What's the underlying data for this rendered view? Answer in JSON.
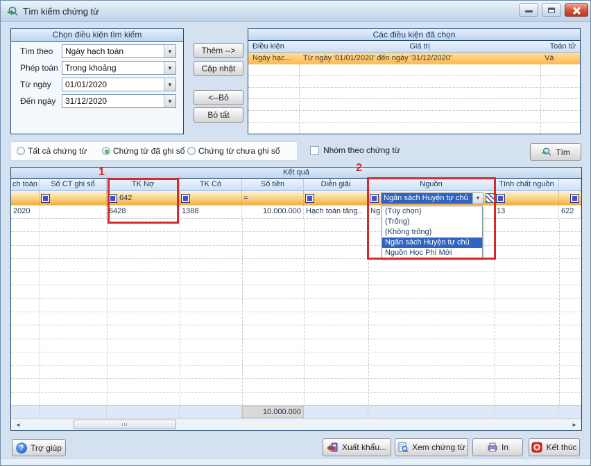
{
  "window": {
    "title": "Tìm kiếm chứng từ"
  },
  "search_panel": {
    "title": "Chọn điều kiện tìm kiếm",
    "fields": [
      {
        "label": "Tìm theo",
        "value": "Ngày hạch toán"
      },
      {
        "label": "Phép toán",
        "value": "Trong khoảng"
      },
      {
        "label": "Từ ngày",
        "value": "01/01/2020"
      },
      {
        "label": "Đến ngày",
        "value": "31/12/2020"
      }
    ]
  },
  "transfer_buttons": {
    "add": "Thêm -->",
    "update": "Cập nhật",
    "remove": "<--Bỏ",
    "remove_all": "Bỏ tất"
  },
  "conditions_panel": {
    "title": "Các điều kiện đã chọn",
    "columns": [
      "Điều kiện",
      "Giá trị",
      "Toán tử"
    ],
    "rows": [
      {
        "condition": "Ngày hạc...",
        "value": "Từ ngày '01/01/2020' đến ngày '31/12/2020'",
        "operator": "Và"
      }
    ]
  },
  "filter_options": {
    "radios": [
      {
        "label": "Tất cả chứng từ",
        "selected": false
      },
      {
        "label": "Chứng từ đã ghi sổ",
        "selected": true
      },
      {
        "label": "Chứng từ chưa ghi sổ",
        "selected": false
      }
    ],
    "group_checkbox": "Nhóm theo chứng từ",
    "search_button": "Tìm"
  },
  "results": {
    "caption": "Kết quả",
    "columns": [
      "ch toán",
      "Số CT ghi sổ",
      "TK Nợ",
      "TK Có",
      "Số tiền",
      "Diễn giải",
      "Nguồn",
      "Tính chất nguồn",
      ""
    ],
    "filters": {
      "tk_no": "642",
      "so_tien_op": "=",
      "nguon": "Ngân sách Huyện tự chủ"
    },
    "row": {
      "date": "2020",
      "so_ct": "",
      "tk_no": "6428",
      "tk_co": "1388",
      "so_tien": "10.000.000",
      "dien_giai": "Hạch toán tăng..",
      "nguon": "Ng",
      "tinh_chat": "13",
      "extra": "622"
    },
    "dropdown": {
      "items": [
        "(Tùy chọn)",
        "(Trống)",
        "(Không trống)",
        "Ngân sách Huyện tự chủ",
        "Nguồn Học Phí Mới"
      ],
      "selected_index": 3
    },
    "sum": "10.000.000"
  },
  "annotations": {
    "one": "1",
    "two": "2"
  },
  "footer": {
    "help": "Trợ giúp",
    "export": "Xuất khẩu...",
    "view": "Xem chứng từ",
    "print": "In",
    "finish": "Kết thúc"
  },
  "colors": {
    "selection_orange": "#fdba45",
    "highlight_blue": "#2f64c1",
    "annotation_red": "#d22b2b",
    "panel_header_blue": "#bed5ef"
  }
}
